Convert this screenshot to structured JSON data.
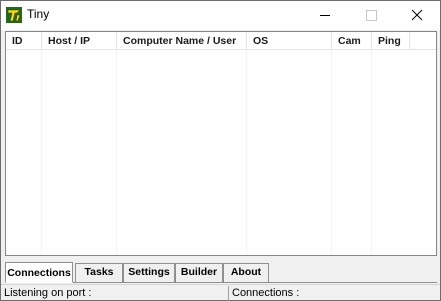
{
  "window": {
    "title": "Tiny",
    "icon": "app-logo-icon",
    "controls": {
      "minimize": "minimize-icon",
      "maximize": "maximize-icon",
      "close": "close-icon"
    }
  },
  "listview": {
    "columns": [
      "ID",
      "Host / IP",
      "Computer Name / User",
      "OS",
      "Cam",
      "Ping"
    ],
    "rows": []
  },
  "tabs": {
    "items": [
      "Connections",
      "Tasks",
      "Settings",
      "Builder",
      "About"
    ],
    "active": "Connections"
  },
  "statusbar": {
    "listening": "Listening on port :",
    "connections": "Connections :"
  },
  "colors": {
    "window_bg": "#f0f0f0",
    "list_bg": "#ffffff",
    "border": "#828790"
  }
}
